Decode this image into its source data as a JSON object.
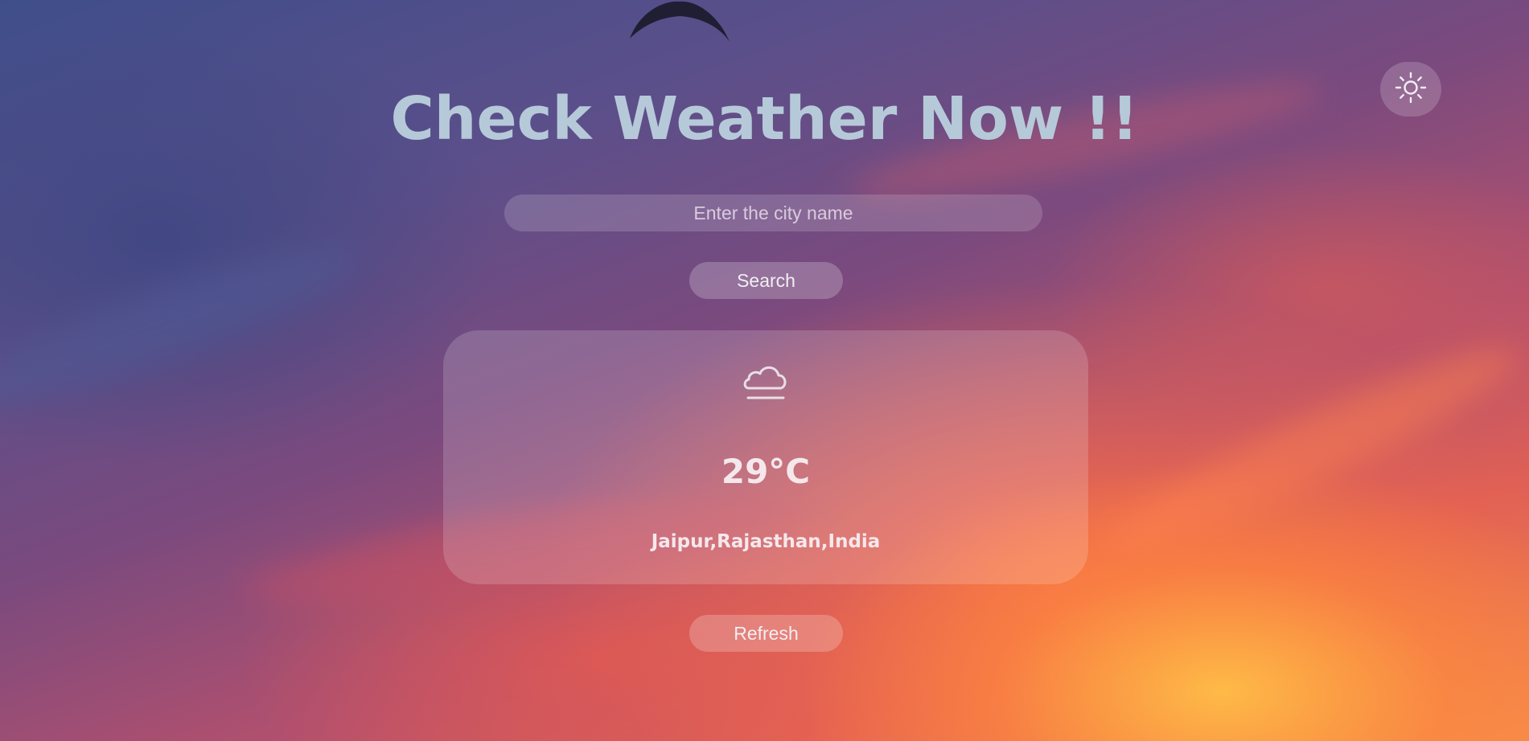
{
  "header": {
    "title": "Check Weather Now !!"
  },
  "theme_toggle": {
    "icon": "sun-icon"
  },
  "search": {
    "placeholder": "Enter the city name",
    "value": "",
    "button_label": "Search"
  },
  "weather": {
    "icon": "cloud-icon",
    "temperature": "29°C",
    "location": "Jaipur,Rajasthan,India"
  },
  "actions": {
    "refresh_label": "Refresh"
  },
  "colors": {
    "title": "#b6c9d9",
    "card_text": "#f5e8ec"
  }
}
